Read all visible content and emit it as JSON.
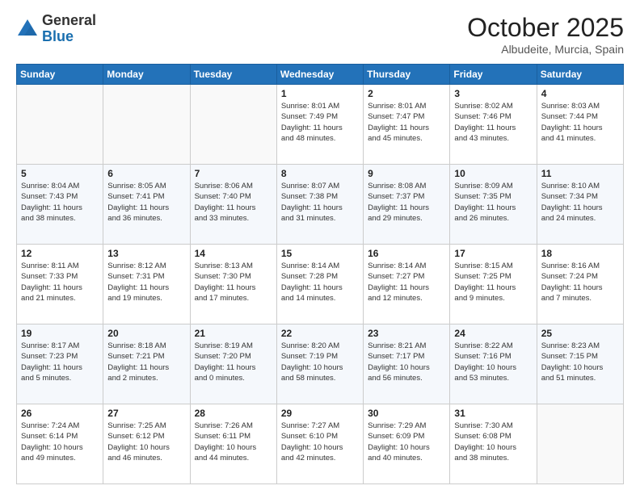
{
  "logo": {
    "general": "General",
    "blue": "Blue"
  },
  "header": {
    "month": "October 2025",
    "location": "Albudeite, Murcia, Spain"
  },
  "weekdays": [
    "Sunday",
    "Monday",
    "Tuesday",
    "Wednesday",
    "Thursday",
    "Friday",
    "Saturday"
  ],
  "weeks": [
    [
      {
        "day": "",
        "info": ""
      },
      {
        "day": "",
        "info": ""
      },
      {
        "day": "",
        "info": ""
      },
      {
        "day": "1",
        "info": "Sunrise: 8:01 AM\nSunset: 7:49 PM\nDaylight: 11 hours\nand 48 minutes."
      },
      {
        "day": "2",
        "info": "Sunrise: 8:01 AM\nSunset: 7:47 PM\nDaylight: 11 hours\nand 45 minutes."
      },
      {
        "day": "3",
        "info": "Sunrise: 8:02 AM\nSunset: 7:46 PM\nDaylight: 11 hours\nand 43 minutes."
      },
      {
        "day": "4",
        "info": "Sunrise: 8:03 AM\nSunset: 7:44 PM\nDaylight: 11 hours\nand 41 minutes."
      }
    ],
    [
      {
        "day": "5",
        "info": "Sunrise: 8:04 AM\nSunset: 7:43 PM\nDaylight: 11 hours\nand 38 minutes."
      },
      {
        "day": "6",
        "info": "Sunrise: 8:05 AM\nSunset: 7:41 PM\nDaylight: 11 hours\nand 36 minutes."
      },
      {
        "day": "7",
        "info": "Sunrise: 8:06 AM\nSunset: 7:40 PM\nDaylight: 11 hours\nand 33 minutes."
      },
      {
        "day": "8",
        "info": "Sunrise: 8:07 AM\nSunset: 7:38 PM\nDaylight: 11 hours\nand 31 minutes."
      },
      {
        "day": "9",
        "info": "Sunrise: 8:08 AM\nSunset: 7:37 PM\nDaylight: 11 hours\nand 29 minutes."
      },
      {
        "day": "10",
        "info": "Sunrise: 8:09 AM\nSunset: 7:35 PM\nDaylight: 11 hours\nand 26 minutes."
      },
      {
        "day": "11",
        "info": "Sunrise: 8:10 AM\nSunset: 7:34 PM\nDaylight: 11 hours\nand 24 minutes."
      }
    ],
    [
      {
        "day": "12",
        "info": "Sunrise: 8:11 AM\nSunset: 7:33 PM\nDaylight: 11 hours\nand 21 minutes."
      },
      {
        "day": "13",
        "info": "Sunrise: 8:12 AM\nSunset: 7:31 PM\nDaylight: 11 hours\nand 19 minutes."
      },
      {
        "day": "14",
        "info": "Sunrise: 8:13 AM\nSunset: 7:30 PM\nDaylight: 11 hours\nand 17 minutes."
      },
      {
        "day": "15",
        "info": "Sunrise: 8:14 AM\nSunset: 7:28 PM\nDaylight: 11 hours\nand 14 minutes."
      },
      {
        "day": "16",
        "info": "Sunrise: 8:14 AM\nSunset: 7:27 PM\nDaylight: 11 hours\nand 12 minutes."
      },
      {
        "day": "17",
        "info": "Sunrise: 8:15 AM\nSunset: 7:25 PM\nDaylight: 11 hours\nand 9 minutes."
      },
      {
        "day": "18",
        "info": "Sunrise: 8:16 AM\nSunset: 7:24 PM\nDaylight: 11 hours\nand 7 minutes."
      }
    ],
    [
      {
        "day": "19",
        "info": "Sunrise: 8:17 AM\nSunset: 7:23 PM\nDaylight: 11 hours\nand 5 minutes."
      },
      {
        "day": "20",
        "info": "Sunrise: 8:18 AM\nSunset: 7:21 PM\nDaylight: 11 hours\nand 2 minutes."
      },
      {
        "day": "21",
        "info": "Sunrise: 8:19 AM\nSunset: 7:20 PM\nDaylight: 11 hours\nand 0 minutes."
      },
      {
        "day": "22",
        "info": "Sunrise: 8:20 AM\nSunset: 7:19 PM\nDaylight: 10 hours\nand 58 minutes."
      },
      {
        "day": "23",
        "info": "Sunrise: 8:21 AM\nSunset: 7:17 PM\nDaylight: 10 hours\nand 56 minutes."
      },
      {
        "day": "24",
        "info": "Sunrise: 8:22 AM\nSunset: 7:16 PM\nDaylight: 10 hours\nand 53 minutes."
      },
      {
        "day": "25",
        "info": "Sunrise: 8:23 AM\nSunset: 7:15 PM\nDaylight: 10 hours\nand 51 minutes."
      }
    ],
    [
      {
        "day": "26",
        "info": "Sunrise: 7:24 AM\nSunset: 6:14 PM\nDaylight: 10 hours\nand 49 minutes."
      },
      {
        "day": "27",
        "info": "Sunrise: 7:25 AM\nSunset: 6:12 PM\nDaylight: 10 hours\nand 46 minutes."
      },
      {
        "day": "28",
        "info": "Sunrise: 7:26 AM\nSunset: 6:11 PM\nDaylight: 10 hours\nand 44 minutes."
      },
      {
        "day": "29",
        "info": "Sunrise: 7:27 AM\nSunset: 6:10 PM\nDaylight: 10 hours\nand 42 minutes."
      },
      {
        "day": "30",
        "info": "Sunrise: 7:29 AM\nSunset: 6:09 PM\nDaylight: 10 hours\nand 40 minutes."
      },
      {
        "day": "31",
        "info": "Sunrise: 7:30 AM\nSunset: 6:08 PM\nDaylight: 10 hours\nand 38 minutes."
      },
      {
        "day": "",
        "info": ""
      }
    ]
  ]
}
